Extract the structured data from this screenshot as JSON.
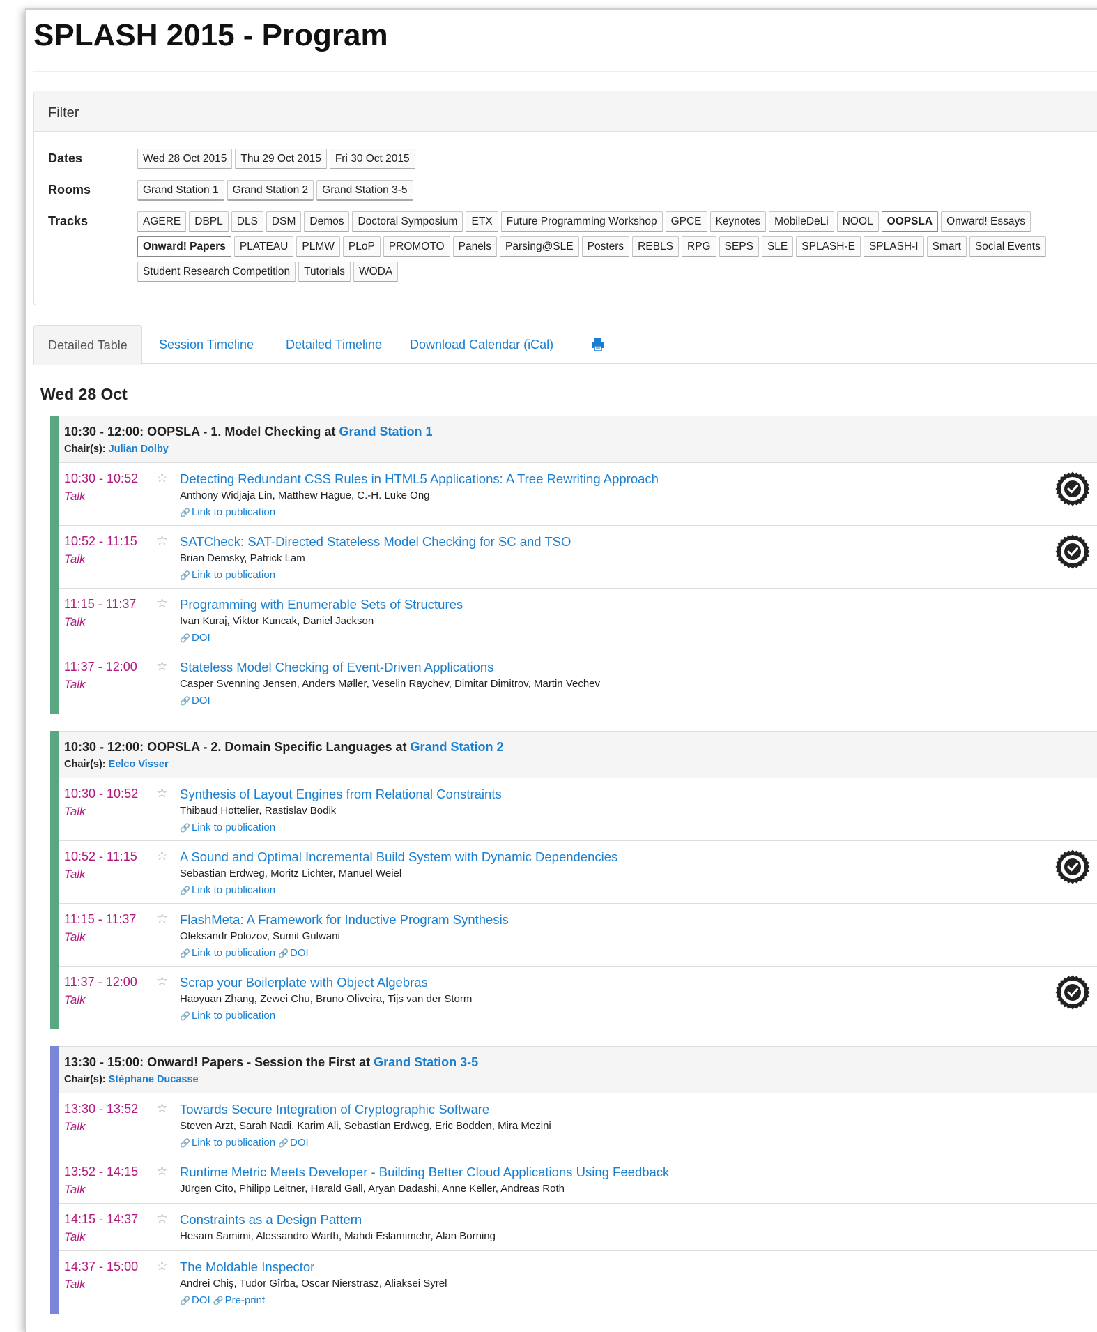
{
  "page": {
    "title": "SPLASH 2015 - Program"
  },
  "filter": {
    "heading": "Filter",
    "dates_label": "Dates",
    "rooms_label": "Rooms",
    "tracks_label": "Tracks",
    "dates": [
      "Wed 28 Oct 2015",
      "Thu 29 Oct 2015",
      "Fri 30 Oct 2015"
    ],
    "rooms": [
      "Grand Station 1",
      "Grand Station 2",
      "Grand Station 3-5"
    ],
    "tracks": [
      {
        "label": "AGERE",
        "active": false
      },
      {
        "label": "DBPL",
        "active": false
      },
      {
        "label": "DLS",
        "active": false
      },
      {
        "label": "DSM",
        "active": false
      },
      {
        "label": "Demos",
        "active": false
      },
      {
        "label": "Doctoral Symposium",
        "active": false
      },
      {
        "label": "ETX",
        "active": false
      },
      {
        "label": "Future Programming Workshop",
        "active": false
      },
      {
        "label": "GPCE",
        "active": false
      },
      {
        "label": "Keynotes",
        "active": false
      },
      {
        "label": "MobileDeLi",
        "active": false
      },
      {
        "label": "NOOL",
        "active": false
      },
      {
        "label": "OOPSLA",
        "active": true
      },
      {
        "label": "Onward! Essays",
        "active": false
      },
      {
        "label": "Onward! Papers",
        "active": true
      },
      {
        "label": "PLATEAU",
        "active": false
      },
      {
        "label": "PLMW",
        "active": false
      },
      {
        "label": "PLoP",
        "active": false
      },
      {
        "label": "PROMOTO",
        "active": false
      },
      {
        "label": "Panels",
        "active": false
      },
      {
        "label": "Parsing@SLE",
        "active": false
      },
      {
        "label": "Posters",
        "active": false
      },
      {
        "label": "REBLS",
        "active": false
      },
      {
        "label": "RPG",
        "active": false
      },
      {
        "label": "SEPS",
        "active": false
      },
      {
        "label": "SLE",
        "active": false
      },
      {
        "label": "SPLASH-E",
        "active": false
      },
      {
        "label": "SPLASH-I",
        "active": false
      },
      {
        "label": "Smart",
        "active": false
      },
      {
        "label": "Social Events",
        "active": false
      },
      {
        "label": "Student Research Competition",
        "active": false
      },
      {
        "label": "Tutorials",
        "active": false
      },
      {
        "label": "WODA",
        "active": false
      }
    ]
  },
  "tabs": {
    "detailed_table": "Detailed Table",
    "session_timeline": "Session Timeline",
    "detailed_timeline": "Detailed Timeline",
    "download_calendar": "Download Calendar (iCal)",
    "print_icon": "print-icon"
  },
  "day": {
    "title": "Wed 28 Oct"
  },
  "colors": {
    "oopsla": "#5aa882",
    "onward": "#7b86d9",
    "link": "#1a7fd0",
    "time": "#b2187e"
  },
  "sessions": [
    {
      "title": "10:30 - 12:00: OOPSLA - 1. Model Checking at ",
      "room": "Grand Station 1",
      "chair_label": "Chair(s): ",
      "chair": "Julian Dolby",
      "talks": [
        {
          "time": "10:30 - 10:52",
          "type": "Talk",
          "title": "Detecting Redundant CSS Rules in HTML5 Applications: A Tree Rewriting Approach",
          "authors": "Anthony Widjaja Lin, Matthew Hague, C.-H. Luke Ong",
          "links": [
            "Link to publication"
          ],
          "badge": true
        },
        {
          "time": "10:52 - 11:15",
          "type": "Talk",
          "title": "SATCheck: SAT-Directed Stateless Model Checking for SC and TSO",
          "authors": "Brian Demsky, Patrick Lam",
          "links": [
            "Link to publication"
          ],
          "badge": true
        },
        {
          "time": "11:15 - 11:37",
          "type": "Talk",
          "title": "Programming with Enumerable Sets of Structures",
          "authors": "Ivan Kuraj, Viktor Kuncak, Daniel Jackson",
          "links": [
            "DOI"
          ],
          "badge": false
        },
        {
          "time": "11:37 - 12:00",
          "type": "Talk",
          "title": "Stateless Model Checking of Event-Driven Applications",
          "authors": "Casper Svenning Jensen, Anders Møller, Veselin Raychev, Dimitar Dimitrov, Martin Vechev",
          "links": [
            "DOI"
          ],
          "badge": false
        }
      ]
    },
    {
      "title": "10:30 - 12:00: OOPSLA - 2. Domain Specific Languages at ",
      "room": "Grand Station 2",
      "chair_label": "Chair(s): ",
      "chair": "Eelco Visser",
      "talks": [
        {
          "time": "10:30 - 10:52",
          "type": "Talk",
          "title": "Synthesis of Layout Engines from Relational Constraints",
          "authors": "Thibaud Hottelier, Rastislav Bodik",
          "links": [
            "Link to publication"
          ],
          "badge": false
        },
        {
          "time": "10:52 - 11:15",
          "type": "Talk",
          "title": "A Sound and Optimal Incremental Build System with Dynamic Dependencies",
          "authors": "Sebastian Erdweg, Moritz Lichter, Manuel Weiel",
          "links": [
            "Link to publication"
          ],
          "badge": true
        },
        {
          "time": "11:15 - 11:37",
          "type": "Talk",
          "title": "FlashMeta: A Framework for Inductive Program Synthesis",
          "authors": "Oleksandr Polozov, Sumit Gulwani",
          "links": [
            "Link to publication",
            "DOI"
          ],
          "badge": false
        },
        {
          "time": "11:37 - 12:00",
          "type": "Talk",
          "title": "Scrap your Boilerplate with Object Algebras",
          "authors": "Haoyuan Zhang, Zewei Chu, Bruno Oliveira, Tijs van der Storm",
          "links": [
            "Link to publication"
          ],
          "badge": true
        }
      ]
    },
    {
      "title": "13:30 - 15:00: Onward! Papers - Session the First at ",
      "room": "Grand Station 3-5",
      "chair_label": "Chair(s): ",
      "chair": "Stéphane Ducasse",
      "talks": [
        {
          "time": "13:30 - 13:52",
          "type": "Talk",
          "title": "Towards Secure Integration of Cryptographic Software",
          "authors": "Steven Arzt, Sarah Nadi, Karim Ali, Sebastian Erdweg, Eric Bodden, Mira Mezini",
          "links": [
            "Link to publication",
            "DOI"
          ],
          "badge": false
        },
        {
          "time": "13:52 - 14:15",
          "type": "Talk",
          "title": "Runtime Metric Meets Developer - Building Better Cloud Applications Using Feedback",
          "authors": "Jürgen Cito, Philipp Leitner, Harald Gall, Aryan Dadashi, Anne Keller, Andreas Roth",
          "links": [],
          "badge": false
        },
        {
          "time": "14:15 - 14:37",
          "type": "Talk",
          "title": "Constraints as a Design Pattern",
          "authors": "Hesam Samimi, Alessandro Warth, Mahdi Eslamimehr, Alan Borning",
          "links": [],
          "badge": false
        },
        {
          "time": "14:37 - 15:00",
          "type": "Talk",
          "title": "The Moldable Inspector",
          "authors": "Andrei Chiş, Tudor Gîrba, Oscar Nierstrasz, Aliaksei Syrel",
          "links": [
            "DOI",
            "Pre-print"
          ],
          "badge": false
        }
      ]
    }
  ]
}
